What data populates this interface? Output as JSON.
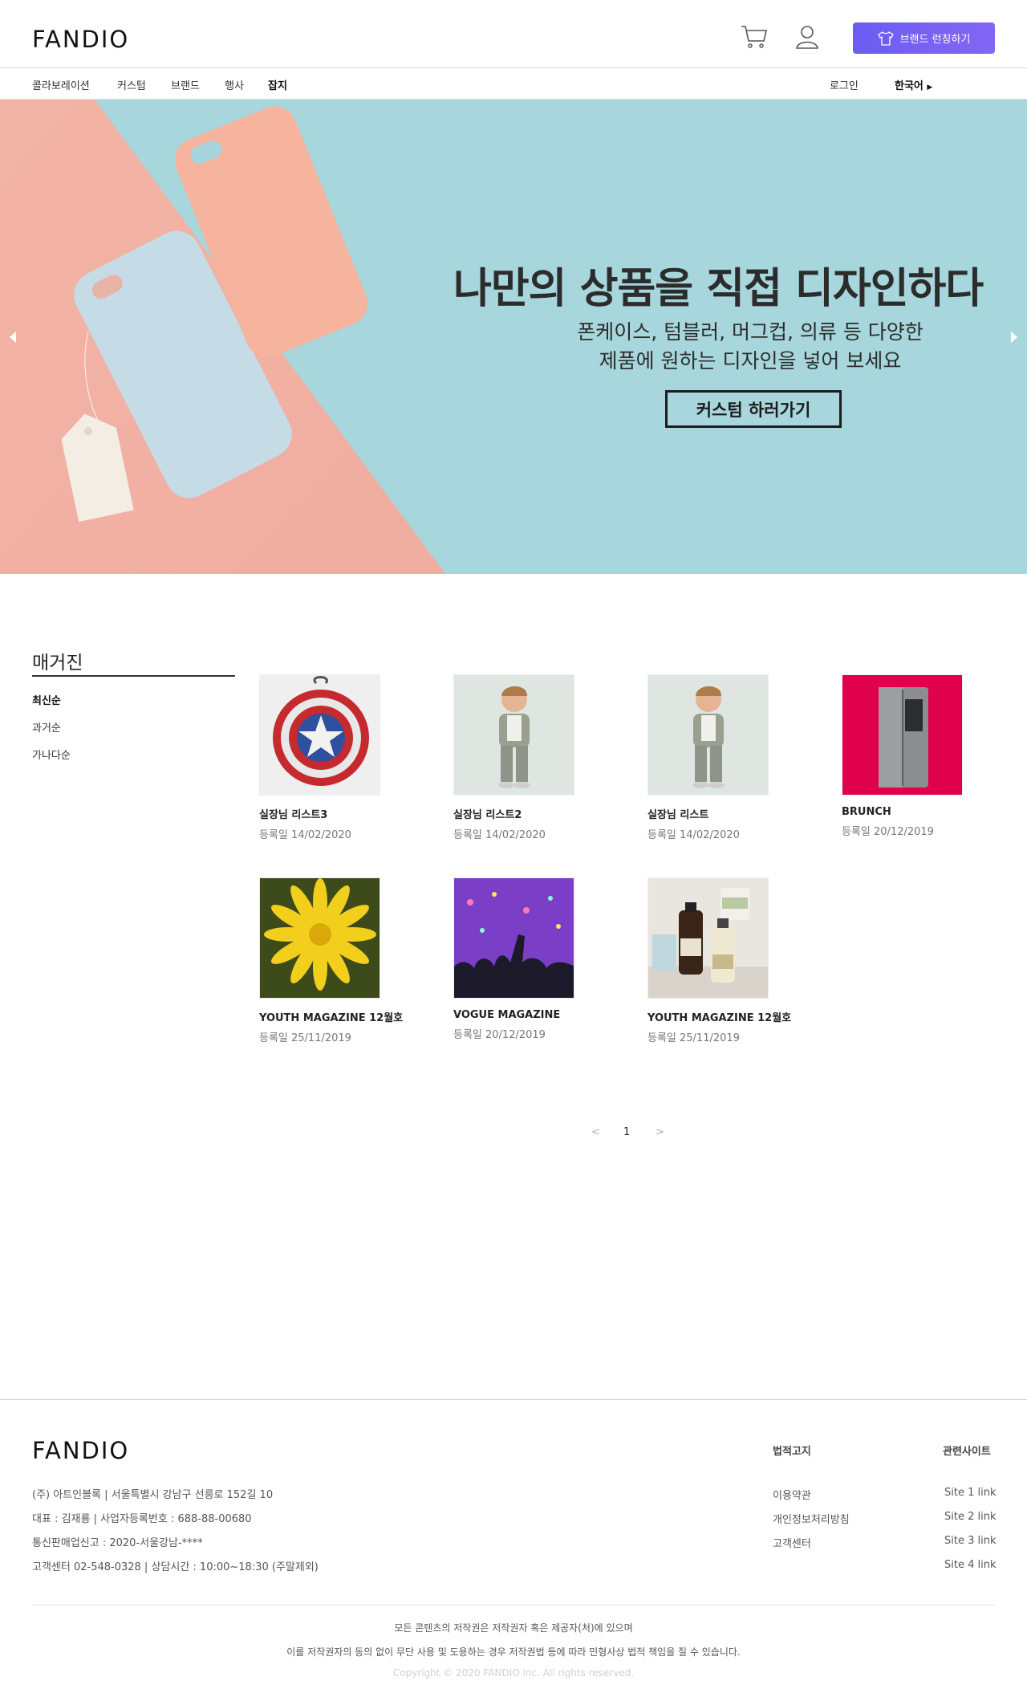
{
  "header": {
    "logo": "FANDIO",
    "brand_button": "브랜드 런칭하기",
    "accent": "#6c63f5"
  },
  "nav": {
    "items": [
      "콜라보레이션",
      "커스텀",
      "브랜드",
      "행사",
      "잡지"
    ],
    "active": "잡지",
    "login": "로그인",
    "language": "한국어"
  },
  "hero": {
    "title": "나만의 상품을 직접 디자인하다",
    "subtitle_1": "폰케이스, 텀블러, 머그컵, 의류 등 다양한",
    "subtitle_2": "제품에 원하는 디자인을 넣어 보세요",
    "cta": "커스텀 하러가기"
  },
  "sidebar": {
    "title": "매거진",
    "sort": [
      "최신순",
      "과거순",
      "가나다순"
    ],
    "active_sort": "최신순"
  },
  "magazines": [
    {
      "title": "실장님 리스트3",
      "date": "등록일 14/02/2020",
      "image": "captain-america-backpack"
    },
    {
      "title": "실장님 리스트2",
      "date": "등록일 14/02/2020",
      "image": "child-photo"
    },
    {
      "title": "실장님 리스트",
      "date": "등록일 14/02/2020",
      "image": "child-photo"
    },
    {
      "title": "BRUNCH",
      "date": "등록일 20/12/2019",
      "image": "refrigerator"
    },
    {
      "title": "YOUTH MAGAZINE 12월호",
      "date": "등록일 25/11/2019",
      "image": "yellow-flower"
    },
    {
      "title": "VOGUE MAGAZINE",
      "date": "등록일 20/12/2019",
      "image": "concert-crowd"
    },
    {
      "title": "YOUTH MAGAZINE 12월호",
      "date": "등록일 25/11/2019",
      "image": "cosmetics"
    }
  ],
  "pagination": {
    "current": "1"
  },
  "footer": {
    "logo": "FANDIO",
    "info": [
      "(주) 아트인블록 | 서울특별시 강남구 선릉로 152길 10",
      "대표 : 김재룡 | 사업자등록번호 : 688-88-00680",
      "통신판매업신고 : 2020-서울강남-****",
      "고객센터 02-548-0328 | 상담시간 : 10:00~18:30 (주말제외)"
    ],
    "legal_title": "법적고지",
    "legal_links": [
      "이용약관",
      "개인정보처리방침",
      "고객센터"
    ],
    "sites_title": "관련사이트",
    "site_links": [
      "Site 1 link",
      "Site 2 link",
      "Site 3 link",
      "Site 4 link"
    ],
    "copyright_1": "모든 콘텐츠의 저작권은 저작권자 혹은 제공자(처)에 있으며",
    "copyright_2": "이를 저작권자의 동의 없이 무단 사용 및 도용하는 경우 저작권법 등에 따라 민형사상 법적 책임을 질 수 있습니다.",
    "copyright_3": "Copyright © 2020 FANDIO inc. All rights reserved."
  }
}
